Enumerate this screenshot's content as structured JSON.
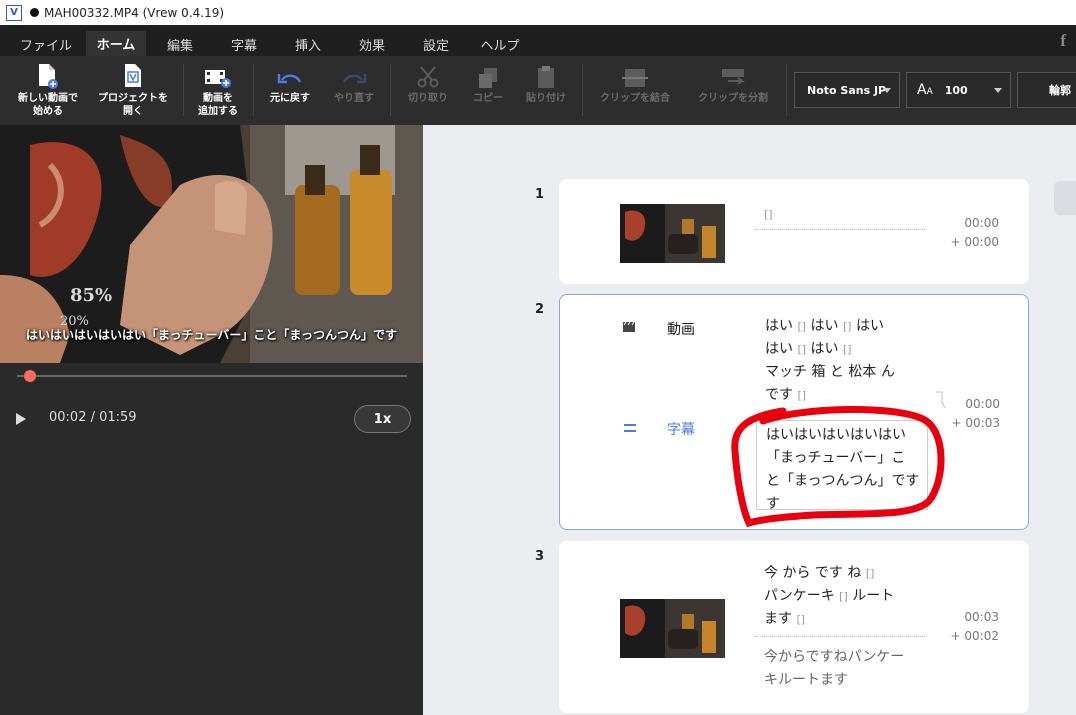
{
  "window": {
    "title": "MAH00332.MP4 (Vrew 0.4.19)",
    "logo_letter": "V"
  },
  "menu": [
    {
      "label": "ファイル",
      "active": false
    },
    {
      "label": "ホーム",
      "active": true
    },
    {
      "label": "編集",
      "active": false
    },
    {
      "label": "字幕",
      "active": false
    },
    {
      "label": "挿入",
      "active": false
    },
    {
      "label": "効果",
      "active": false
    },
    {
      "label": "設定",
      "active": false
    },
    {
      "label": "ヘルプ",
      "active": false
    }
  ],
  "toolbar": {
    "new_video": "新しい動画で\n始める",
    "open_project": "プロジェクトを\n開く",
    "add_video": "動画を\n追加する",
    "undo": "元に戻す",
    "redo": "やり直す",
    "cut": "切り取り",
    "copy": "コピー",
    "paste": "貼り付け",
    "merge": "クリップを結合",
    "split": "クリップを分割",
    "font": "Noto Sans JP",
    "font_size": "100",
    "outline": "輪郭"
  },
  "player": {
    "overlay_subtitle": "はいはいはいはいはい「まっチューバー」こと「まっつんつん」です",
    "time": "00:02 / 01:59",
    "speed": "1x",
    "progress": 0.017
  },
  "clips": [
    {
      "number": "1",
      "words": [
        [
          "[]"
        ]
      ],
      "time_start": "00:00",
      "time_dur": "+ 00:00"
    },
    {
      "number": "2",
      "label_video": "動画",
      "label_subtitle": "字幕",
      "words": [
        [
          "はい",
          "[]",
          "はい",
          "[]",
          "はい"
        ],
        [
          "はい",
          "[]",
          "はい",
          "[]"
        ],
        [
          "マッチ",
          "箱",
          "と",
          "松本",
          "ん"
        ],
        [
          "です",
          "[]"
        ]
      ],
      "subtitle_lines": [
        "はいはいはいはいはい",
        "「まっチューバー」こ",
        "と「まっつんつん」です",
        "す"
      ],
      "time_start": "00:00",
      "time_dur": "+ 00:03"
    },
    {
      "number": "3",
      "words": [
        [
          "今",
          "から",
          "です",
          "ね",
          "[]"
        ],
        [
          "パンケーキ",
          "[]",
          "ルート"
        ],
        [
          "ます",
          "[]"
        ]
      ],
      "subtitle_lines": [
        "今からですねパンケー",
        "キルートます"
      ],
      "time_start": "00:03",
      "time_dur": "+ 00:02"
    }
  ],
  "colors": {
    "accent": "#4a7de0",
    "seek": "#ff6b5b",
    "annotation": "#e8000f"
  }
}
